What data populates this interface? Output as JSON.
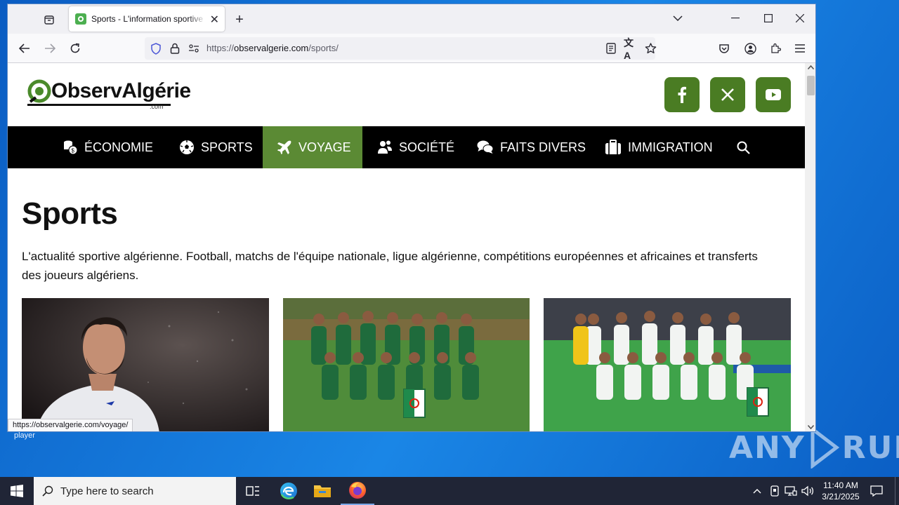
{
  "browser": {
    "tab_title": "Sports - L'information sportive algérienne",
    "url_prefix": "https://",
    "url_domain": "observalgerie.com",
    "url_path": "/sports/",
    "status_url": "https://observalgerie.com/voyage/"
  },
  "site": {
    "logo_text_a": "Observ",
    "logo_text_b": "Algérie",
    "logo_sub": ".com",
    "nav": [
      {
        "label": "ÉCONOMIE",
        "icon": "coins-icon"
      },
      {
        "label": "SPORTS",
        "icon": "soccer-ball-icon"
      },
      {
        "label": "VOYAGE",
        "icon": "plane-icon"
      },
      {
        "label": "SOCIÉTÉ",
        "icon": "people-icon"
      },
      {
        "label": "FAITS DIVERS",
        "icon": "comments-icon"
      },
      {
        "label": "IMMIGRATION",
        "icon": "suitcase-icon"
      }
    ],
    "social": [
      "facebook-icon",
      "x-icon",
      "youtube-icon"
    ],
    "brand_green": "#5b8a34"
  },
  "page": {
    "title": "Sports",
    "description": "L'actualité sportive algérienne. Football, matchs de l'équipe nationale, ligue algérienne, compétitions européennes et africaines et transferts des joueurs algériens."
  },
  "desktop": {
    "label": "player",
    "watermark_a": "ANY",
    "watermark_b": "RUN"
  },
  "taskbar": {
    "search_placeholder": "Type here to search",
    "time": "11:40 AM",
    "date": "3/21/2025"
  }
}
